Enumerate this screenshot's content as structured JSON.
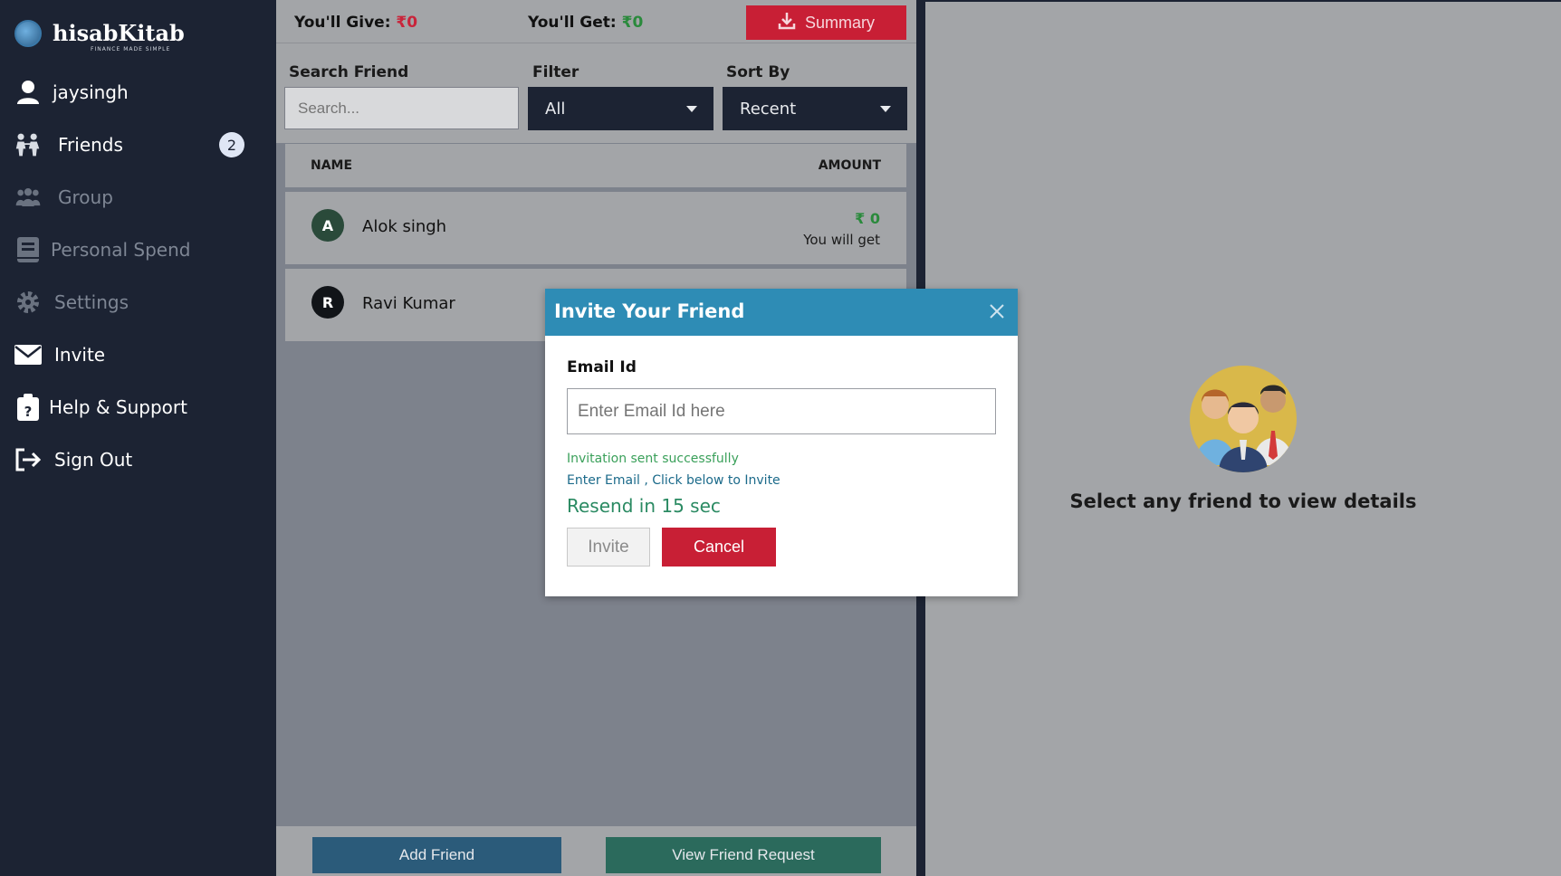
{
  "app": {
    "brand": "hisabKitab",
    "tagline": "FINANCE MADE SIMPLE"
  },
  "sidebar": {
    "username": "jaysingh",
    "items": [
      {
        "label": "Friends",
        "icon": "friends-icon"
      },
      {
        "label": "Group",
        "icon": "group-icon"
      },
      {
        "label": "Personal Spend",
        "icon": "book-icon"
      },
      {
        "label": "Settings",
        "icon": "gear-icon"
      },
      {
        "label": "Invite",
        "icon": "envelope-icon"
      },
      {
        "label": "Help & Support",
        "icon": "clipboard-question-icon"
      },
      {
        "label": "Sign Out",
        "icon": "sign-out-icon"
      }
    ],
    "friends_badge": "2"
  },
  "topbar": {
    "give_label": "You'll Give:",
    "give_value": "₹0",
    "get_label": "You'll Get:",
    "get_value": "₹0",
    "summary_label": "Summary"
  },
  "filters": {
    "search_label": "Search Friend",
    "search_placeholder": "Search...",
    "filter_label": "Filter",
    "filter_value": "All",
    "sort_label": "Sort By",
    "sort_value": "Recent"
  },
  "table": {
    "col_name": "NAME",
    "col_amount": "AMOUNT",
    "rows": [
      {
        "initial": "A",
        "name": "Alok singh",
        "amount": "₹ 0",
        "note": "You will get"
      },
      {
        "initial": "R",
        "name": "Ravi Kumar"
      }
    ]
  },
  "bottom": {
    "add_friend": "Add Friend",
    "view_requests": "View Friend Request"
  },
  "right_panel": {
    "message": "Select any friend to view details"
  },
  "modal": {
    "title": "Invite Your Friend",
    "email_label": "Email Id",
    "email_placeholder": "Enter Email Id here",
    "success_msg": "Invitation sent successfully",
    "hint_msg": "Enter Email , Click below to Invite",
    "resend_msg": "Resend in 15 sec",
    "invite_label": "Invite",
    "cancel_label": "Cancel"
  },
  "colors": {
    "sidebar_bg": "#1c2333",
    "accent_red": "#c81f35",
    "modal_header": "#2e8cb5",
    "add_friend_btn": "#2b5b7a",
    "view_request_btn": "#2b6a5c"
  }
}
